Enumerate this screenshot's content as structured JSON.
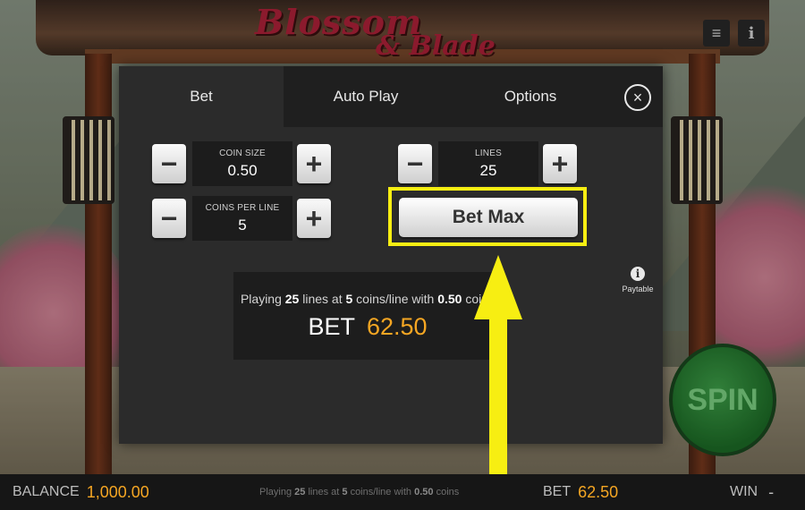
{
  "game": {
    "title_line1": "Blossom",
    "title_line2": "& Blade"
  },
  "top_buttons": {
    "menu_icon": "hamburger-menu-icon",
    "info_icon": "info-icon"
  },
  "modal": {
    "tabs": [
      {
        "label": "Bet",
        "active": true
      },
      {
        "label": "Auto Play",
        "active": false
      },
      {
        "label": "Options",
        "active": false
      }
    ],
    "close_icon": "close-circle-icon",
    "coin_size": {
      "label": "COIN SIZE",
      "value": "0.50"
    },
    "coins_per_line": {
      "label": "COINS PER LINE",
      "value": "5"
    },
    "lines": {
      "label": "LINES",
      "value": "25"
    },
    "minus_symbol": "−",
    "plus_symbol": "+",
    "bet_max_label": "Bet Max",
    "summary": {
      "prefix": "Playing",
      "lines": "25",
      "mid1": "lines at",
      "coins": "5",
      "mid2": "coins/line with",
      "coin_size": "0.50",
      "suffix": "coins",
      "bet_label": "BET",
      "bet_value": "62.50"
    },
    "paytable_label": "Paytable"
  },
  "spin_label": "SPIN",
  "bottom_bar": {
    "balance_label": "BALANCE",
    "balance_value": "1,000.00",
    "info": {
      "prefix": "Playing",
      "lines": "25",
      "mid1": "lines at",
      "coins": "5",
      "mid2": "coins/line with",
      "coin_size": "0.50",
      "suffix": "coins"
    },
    "bet_label": "BET",
    "bet_value": "62.50",
    "win_label": "WIN",
    "win_value": "-"
  },
  "colors": {
    "accent_orange": "#f5a623",
    "highlight_yellow": "#f7ee12",
    "modal_bg": "#2b2b2b"
  }
}
